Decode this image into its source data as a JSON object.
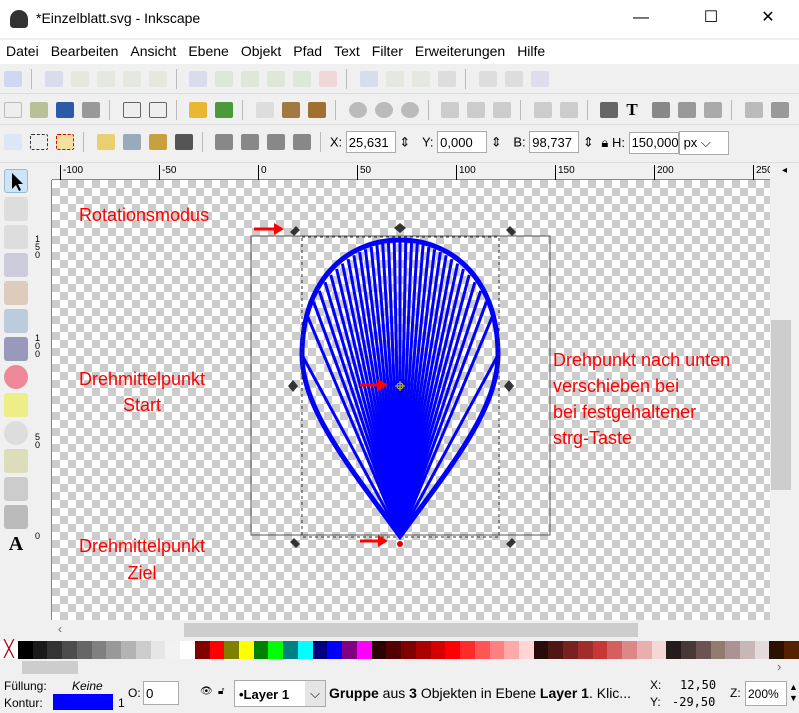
{
  "window": {
    "title": "*Einzelblatt.svg - Inkscape",
    "minimize": "—",
    "maximize": "☐",
    "close": "✕"
  },
  "menu": [
    "Datei",
    "Bearbeiten",
    "Ansicht",
    "Ebene",
    "Objekt",
    "Pfad",
    "Text",
    "Filter",
    "Erweiterungen",
    "Hilfe"
  ],
  "toolbar_coords": {
    "x_label": "X:",
    "x": "25,631",
    "y_label": "Y:",
    "y": "0,000",
    "w_label": "B:",
    "w": "98,737",
    "h_label": "H:",
    "h": "150,000",
    "unit": "px"
  },
  "ruler": {
    "h_ticks": [
      "-100",
      "-50",
      "0",
      "50",
      "100",
      "150",
      "200",
      "250"
    ],
    "v_ticks": [
      "150",
      "100",
      "50",
      "0"
    ]
  },
  "annotations": {
    "rotation": "Rotationsmodus",
    "start": "Drehmittelpunkt\nStart",
    "target": "Drehmittelpunkt\nZiel",
    "note": "Drehpunkt nach unten\nverschieben bei\nbei festgehaltener\nstrg-Taste"
  },
  "colors": {
    "stroke": "#0000ff",
    "accent_arrow": "#ff0000"
  },
  "palette": [
    "#000000",
    "#1a1a1a",
    "#333333",
    "#4d4d4d",
    "#666666",
    "#808080",
    "#999999",
    "#b3b3b3",
    "#cccccc",
    "#e6e6e6",
    "#f2f2f2",
    "#ffffff",
    "#800000",
    "#ff0000",
    "#808000",
    "#ffff00",
    "#008000",
    "#00ff00",
    "#008080",
    "#00ffff",
    "#000080",
    "#0000ff",
    "#800080",
    "#ff00ff",
    "#2b0000",
    "#550000",
    "#800000",
    "#aa0000",
    "#d40000",
    "#ff0000",
    "#ff2a2a",
    "#ff5555",
    "#ff8080",
    "#ffaaaa",
    "#ffd5d5",
    "#280b0b",
    "#501616",
    "#782121",
    "#a02c2c",
    "#c83737",
    "#d35f5f",
    "#de8787",
    "#e9afaf",
    "#f4d7d7",
    "#241c1c",
    "#483737",
    "#6c5353",
    "#917c6f",
    "#ac9393",
    "#c8b7b7",
    "#e3dbdb",
    "#2b1100",
    "#552200"
  ],
  "status": {
    "fill_label": "Füllung:",
    "fill_value": "Keine",
    "stroke_label": "Kontur:",
    "stroke_width": "1",
    "opacity_label": "O:",
    "opacity": "0",
    "layer": "•Layer 1",
    "message_pre": "Gruppe",
    "message_mid1": " aus ",
    "message_count": "3",
    "message_mid2": " Objekten in Ebene ",
    "message_layer": "Layer 1",
    "message_post": ". Klic...",
    "x_label": "X:",
    "x": "12,50",
    "y_label": "Y:",
    "y": "-29,50",
    "zoom_label": "Z:",
    "zoom": "200%"
  }
}
